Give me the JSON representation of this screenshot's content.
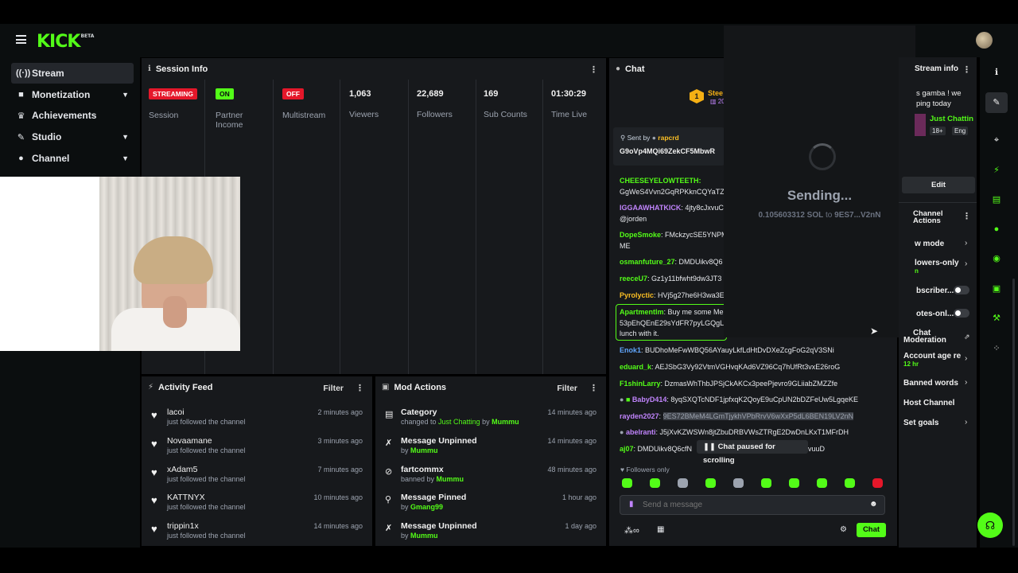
{
  "brand": {
    "logo": "KICK",
    "tag": "BETA"
  },
  "sidebar": {
    "items": [
      {
        "label": "Stream",
        "icon": "broadcast-icon",
        "active": true
      },
      {
        "label": "Monetization",
        "icon": "dollar-icon",
        "chevron": true
      },
      {
        "label": "Achievements",
        "icon": "trophy-icon"
      },
      {
        "label": "Studio",
        "icon": "pen-icon",
        "chevron": true
      },
      {
        "label": "Channel",
        "icon": "user-icon",
        "chevron": true
      }
    ]
  },
  "session": {
    "title": "Session Info",
    "stats": [
      {
        "badge": "STREAMING",
        "badge_color": "#e5172a",
        "label": "Session"
      },
      {
        "badge": "ON",
        "badge_color": "#53fc18",
        "label": "Partner Income"
      },
      {
        "badge": "OFF",
        "badge_color": "#e5172a",
        "label": "Multistream"
      },
      {
        "value": "1,063",
        "label": "Viewers"
      },
      {
        "value": "22,689",
        "label": "Followers"
      },
      {
        "value": "169",
        "label": "Sub Counts"
      },
      {
        "value": "01:30:29",
        "label": "Time Live"
      }
    ]
  },
  "activity": {
    "title": "Activity Feed",
    "filter": "Filter",
    "rows": [
      {
        "name": "lacoi",
        "sub": "just followed the channel",
        "time": "2 minutes ago"
      },
      {
        "name": "Novaamane",
        "sub": "just followed the channel",
        "time": "3 minutes ago"
      },
      {
        "name": "xAdam5",
        "sub": "just followed the channel",
        "time": "7 minutes ago"
      },
      {
        "name": "KATTNYX",
        "sub": "just followed the channel",
        "time": "10 minutes ago"
      },
      {
        "name": "trippin1x",
        "sub": "just followed the channel",
        "time": "14 minutes ago"
      }
    ]
  },
  "mod": {
    "title": "Mod Actions",
    "filter": "Filter",
    "rows": [
      {
        "name": "Category",
        "pre": "changed to ",
        "hl": "Just Chatting",
        "mid": " by ",
        "user": "Mummu",
        "time": "14 minutes ago"
      },
      {
        "name": "Message Unpinned",
        "pre": "by ",
        "user": "Mummu",
        "time": "14 minutes ago"
      },
      {
        "name": "fartcommx",
        "pre": "banned by ",
        "user": "Mummu",
        "time": "48 minutes ago"
      },
      {
        "name": "Message Pinned",
        "pre": "by ",
        "user": "Gmang99",
        "time": "1 hour ago"
      },
      {
        "name": "Message Unpinned",
        "pre": "by ",
        "user": "Mummu",
        "time": "1 day ago"
      }
    ]
  },
  "chat": {
    "title": "Chat",
    "top_user": "Stee",
    "top_sub": "20",
    "pinned_by_label": "Sent by",
    "pinned_by": "rapcrd",
    "pinned_text": "G9oVp4MQi69ZekCF5MbwR",
    "messages": [
      {
        "user": "CHEESEYELOWTEETH:",
        "color": "#53fc18",
        "text": "",
        "line2": "GgWeS4Vvn2GqRPKknCQYaTZ"
      },
      {
        "user": "IGGAAWHATKICK",
        "color": "#c084fc",
        "text": ": 4jty8cJxvuC",
        "line2": "@jorden"
      },
      {
        "user": "DopeSmoke",
        "color": "#53fc18",
        "text": ": FMckzycSE5YNPM",
        "line2": "ME"
      },
      {
        "user": "osmanfuture_27",
        "color": "#53fc18",
        "text": ": DMDUikv8Q6"
      },
      {
        "user": "reeceU7",
        "color": "#53fc18",
        "text": ": Gz1y11bfwht9dw3JT3"
      },
      {
        "user": "Pyrolyctic",
        "color": "#fbbf24",
        "text": ": HVj5g27he6H3wa3E"
      },
      {
        "user": "ApartmentIm",
        "color": "#53fc18",
        "text": ": Buy me some Me",
        "line2": "53pEhQEnE29sYdFR7pyLGQgL5",
        "line3": "lunch with it."
      },
      {
        "user": "Enok1",
        "color": "#60a5fa",
        "text": ": BUDhoMeFwWBQ56AYauyLkfLdHtDvDXeZcgFoG2qV3SNi"
      },
      {
        "user": "eduard_k",
        "color": "#53fc18",
        "text": ": AEJSbG3Vy92VtmVGHvqKAd6VZ96Cq7hUfRt3vxE26roG"
      },
      {
        "user": "F1shinLarry",
        "color": "#53fc18",
        "text": ": DzmasWhThbJPSjCkAKCx3peePjevro9GLiiabZMZZfe"
      },
      {
        "user": "BabyD414",
        "color": "#c084fc",
        "text": ": 8yqSXQTcNDF1jpfxqK2QoyE9uCpUN2bDZFeUw5LgqeKE"
      },
      {
        "user": "rayden2027",
        "color": "#c084fc",
        "text": ": ",
        "sel": "9ES72BMeM4LGmTjykhVPbRrvV6wXxP5dL6BEN19LV2nN"
      },
      {
        "user": "abelranti",
        "color": "#c084fc",
        "text": ": J5jXvKZWSWn8jtZbuDRBVWsZTRgE2DwDnLKxT1MFrDH"
      },
      {
        "user": "aj07",
        "color": "#53fc18",
        "text": ": DMDUikv8Q6cfN",
        "tail": "vuuD"
      }
    ],
    "paused": "Chat paused for scrolling",
    "followers_only": "Followers only",
    "input_placeholder": "Send a message",
    "send_label": "Chat"
  },
  "overlay": {
    "sending": "Sending...",
    "amount": "0.105603312 SOL",
    "to_label": "to",
    "address": "9ES7...V2nN"
  },
  "stream_info": {
    "title": "Stream info",
    "desc1": "s gamba ! we",
    "desc2": "ping today",
    "category": "Just Chattin",
    "age": "18+",
    "lang": "Eng",
    "edit": "Edit"
  },
  "channel_actions": {
    "title1": "Channel",
    "title2": "Actions",
    "items": [
      {
        "label": "w mode",
        "type": "chevron"
      },
      {
        "label": "lowers-only",
        "type": "chevron",
        "sub": "n"
      },
      {
        "label": "bscriber...",
        "type": "toggle"
      },
      {
        "label": "otes-onl...",
        "type": "toggle"
      },
      {
        "label": "Chat",
        "label2": "Moderation",
        "type": "external"
      },
      {
        "label": "Account age res",
        "type": "chevron",
        "sub": "12 hr"
      },
      {
        "label": "Banned words",
        "type": "chevron"
      },
      {
        "label": "Host Channel",
        "type": "none"
      },
      {
        "label": "Set goals",
        "type": "chevron"
      }
    ]
  },
  "colors": {
    "accent": "#53fc18",
    "danger": "#e5172a",
    "panel": "#17191c",
    "bg": "#0b0e0f"
  }
}
